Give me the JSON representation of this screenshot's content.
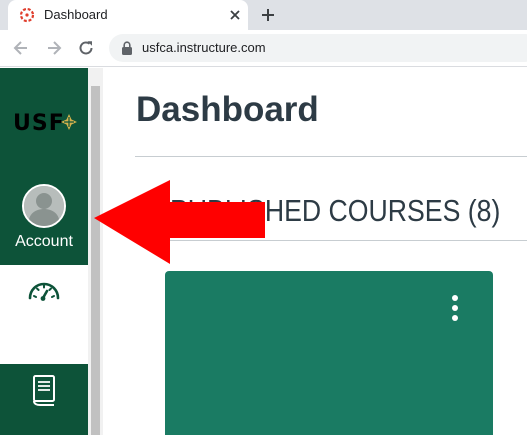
{
  "browser": {
    "tab_title": "Dashboard",
    "url": "usfca.instructure.com"
  },
  "nav": {
    "logo_text": "USF",
    "account_label": "Account",
    "items": [
      {
        "icon": "account-avatar-icon",
        "label": "Account"
      },
      {
        "icon": "dashboard-speedometer-icon"
      },
      {
        "icon": "courses-book-icon"
      }
    ]
  },
  "main": {
    "page_title": "Dashboard",
    "section_title": "PUBLISHED COURSES (8)",
    "course_card": {
      "color": "#1a7b63"
    }
  },
  "colors": {
    "nav_brand": "#0d5339",
    "logo_gold": "#d4b24c",
    "annotation_arrow": "#ff0000",
    "text": "#2d3b45"
  }
}
